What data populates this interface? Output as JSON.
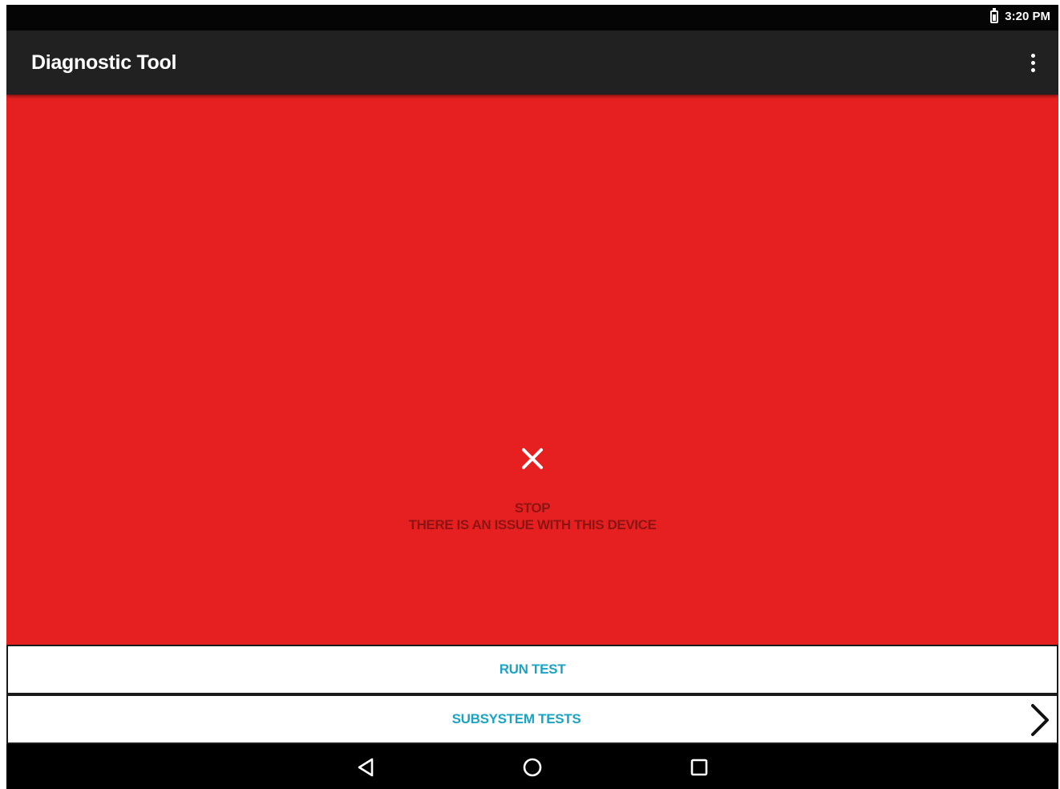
{
  "status_bar": {
    "time": "3:20 PM",
    "icons": [
      "battery-icon"
    ]
  },
  "app_bar": {
    "title": "Diagnostic Tool",
    "menu_icon": "overflow-menu-icon"
  },
  "status_panel": {
    "background_color": "#e62020",
    "icon": "close-icon",
    "line1": "STOP",
    "line2": "THERE IS AN ISSUE WITH THIS DEVICE"
  },
  "actions": {
    "run_test": "RUN TEST",
    "subsystem_tests": "SUBSYSTEM TESTS",
    "label_color": "#1aa3c4"
  },
  "nav_bar": {
    "buttons": [
      "back-icon",
      "home-icon",
      "recents-icon"
    ]
  }
}
